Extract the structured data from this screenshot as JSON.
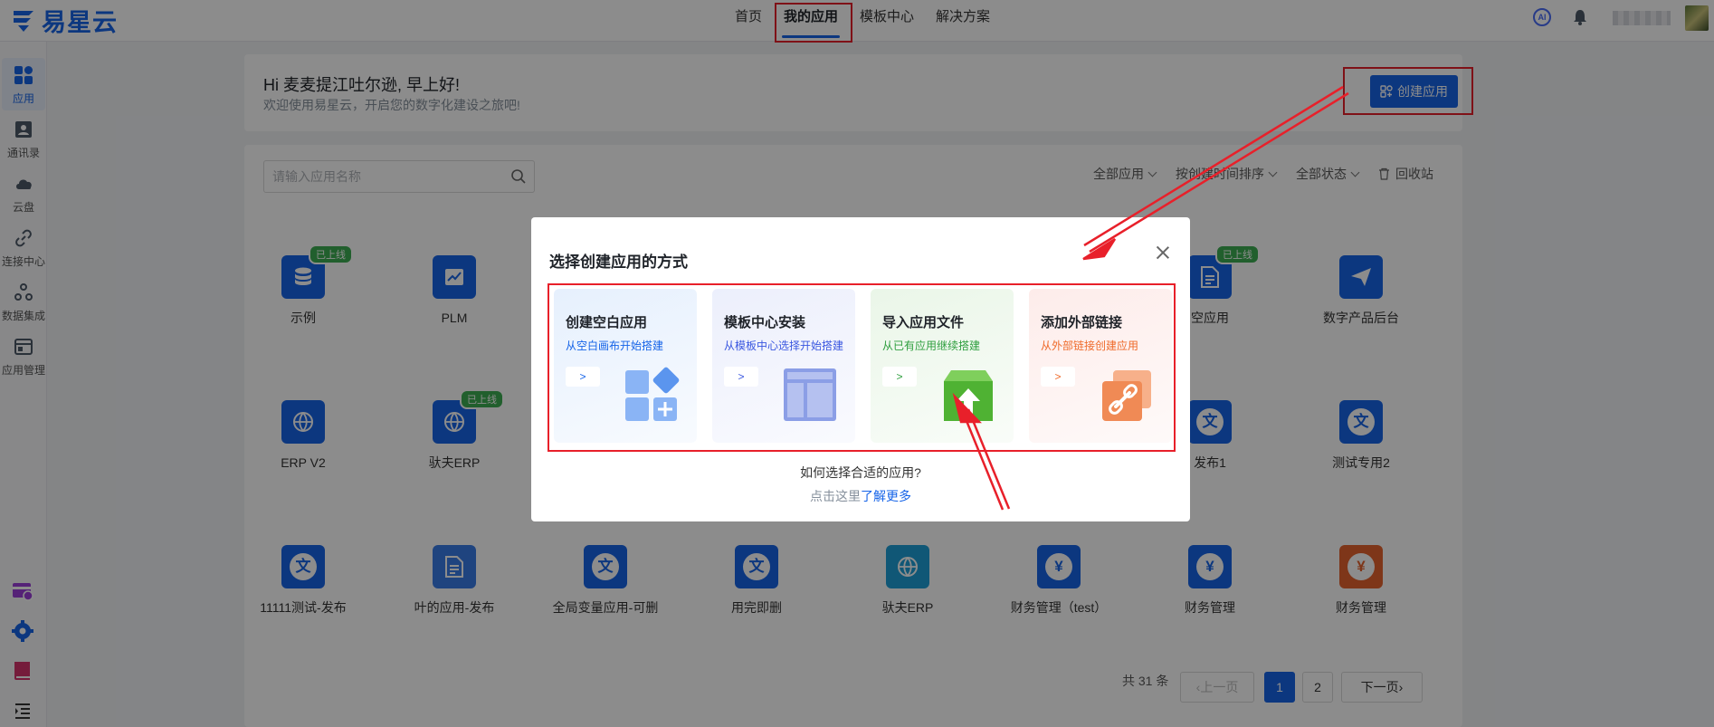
{
  "app": {
    "brand": "易星云"
  },
  "topnav": {
    "items": [
      {
        "label": "首页"
      },
      {
        "label": "我的应用",
        "active": true
      },
      {
        "label": "模板中心"
      },
      {
        "label": "解决方案"
      }
    ],
    "ai_label": "AI"
  },
  "sidebar": {
    "items": [
      {
        "label": "应用",
        "icon": "grid-icon",
        "active": true
      },
      {
        "label": "通讯录",
        "icon": "contacts-icon"
      },
      {
        "label": "云盘",
        "icon": "cloud-icon"
      },
      {
        "label": "连接中心",
        "icon": "link-icon"
      },
      {
        "label": "数据集成",
        "icon": "data-integration-icon"
      },
      {
        "label": "应用管理",
        "icon": "app-manage-icon"
      }
    ]
  },
  "greeting": {
    "title": "Hi  麦麦提江吐尔逊, 早上好!",
    "subtitle": "欢迎使用易星云，开启您的数字化建设之旅吧!"
  },
  "toolbar": {
    "create_label": "创建应用",
    "search_placeholder": "请输入应用名称",
    "filters": [
      "全部应用",
      "按创建时间排序",
      "全部状态"
    ],
    "recycle_label": "回收站"
  },
  "apps": [
    {
      "name": "示例",
      "color": "#1664e8",
      "glyph": "db",
      "badge": "已上线"
    },
    {
      "name": "PLM",
      "color": "#1664e8",
      "glyph": "chart"
    },
    {
      "name": "空应用",
      "color": "#1664e8",
      "glyph": "doc",
      "badge": "已上线"
    },
    {
      "name": "数字产品后台",
      "color": "#1664e8",
      "glyph": "send"
    },
    {
      "name": "ERP V2",
      "color": "#1664e8",
      "glyph": "globe"
    },
    {
      "name": "驮夫ERP",
      "color": "#1664e8",
      "glyph": "globe",
      "badge": "已上线"
    },
    {
      "name": "发布1",
      "color": "#1664e8",
      "glyph": "文"
    },
    {
      "name": "测试专用2",
      "color": "#1664e8",
      "glyph": "文"
    },
    {
      "name": "11111测试-发布",
      "color": "#1664e8",
      "glyph": "文"
    },
    {
      "name": "叶的应用-发布",
      "color": "#3a7ce8",
      "glyph": "doc"
    },
    {
      "name": "全局变量应用-可删",
      "color": "#1664e8",
      "glyph": "文"
    },
    {
      "name": "用完即删",
      "color": "#1664e8",
      "glyph": "文"
    },
    {
      "name": "驮夫ERP",
      "color": "#1e9fd8",
      "glyph": "globe"
    },
    {
      "name": "财务管理（test）",
      "color": "#1664e8",
      "glyph": "¥"
    },
    {
      "name": "财务管理",
      "color": "#1664e8",
      "glyph": "¥"
    },
    {
      "name": "财务管理",
      "color": "#e5632e",
      "glyph": "¥"
    }
  ],
  "pagination": {
    "total": "共 31 条",
    "prev": "上一页",
    "pages": [
      "1",
      "2"
    ],
    "current": "1",
    "next": "下一页"
  },
  "modal": {
    "title": "选择创建应用的方式",
    "cards": [
      {
        "title": "创建空白应用",
        "subtitle": "从空白画布开始搭建",
        "accent": "#1664e8",
        "bg": "#e6f0fd"
      },
      {
        "title": "模板中心安装",
        "subtitle": "从模板中心选择开始搭建",
        "accent": "#3a57e0",
        "bg": "#eceffc"
      },
      {
        "title": "导入应用文件",
        "subtitle": "从已有应用继续搭建",
        "accent": "#2e9e3e",
        "bg": "#eaf6e8"
      },
      {
        "title": "添加外部链接",
        "subtitle": "从外部链接创建应用",
        "accent": "#ef6a2a",
        "bg": "#fdecea"
      }
    ],
    "how": "如何选择合适的应用?",
    "more_prefix": "点击这里",
    "more_link": "了解更多"
  },
  "colors": {
    "accent": "#1664e8",
    "annotation": "#e8202a",
    "badge": "#3dae52"
  }
}
